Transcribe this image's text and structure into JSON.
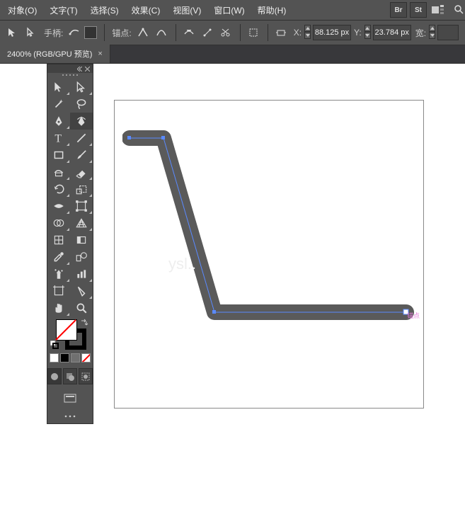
{
  "menu": {
    "items": [
      "对象(O)",
      "文字(T)",
      "选择(S)",
      "效果(C)",
      "视图(V)",
      "窗口(W)",
      "帮助(H)"
    ]
  },
  "menu_buttons": [
    "Br",
    "St"
  ],
  "toolbar": {
    "handle_label": "手柄:",
    "anchor_label": "锚点:",
    "x_label": "X:",
    "y_label": "Y:",
    "x_value": "88.125 px",
    "y_value": "23.784 px",
    "width_label": "宽:",
    "width_value": ""
  },
  "tab": {
    "label": "2400% (RGB/GPU 预览)",
    "close": "×"
  },
  "anchor_label": "锚点",
  "watermark": "ysl..",
  "swatches": [
    {
      "bg": "#fff",
      "border": "#888"
    },
    {
      "bg": "#000",
      "border": "#888"
    },
    {
      "bg": "#707070",
      "border": "#888"
    },
    {
      "bg": "#fff",
      "border": "#888",
      "slash": true
    }
  ]
}
